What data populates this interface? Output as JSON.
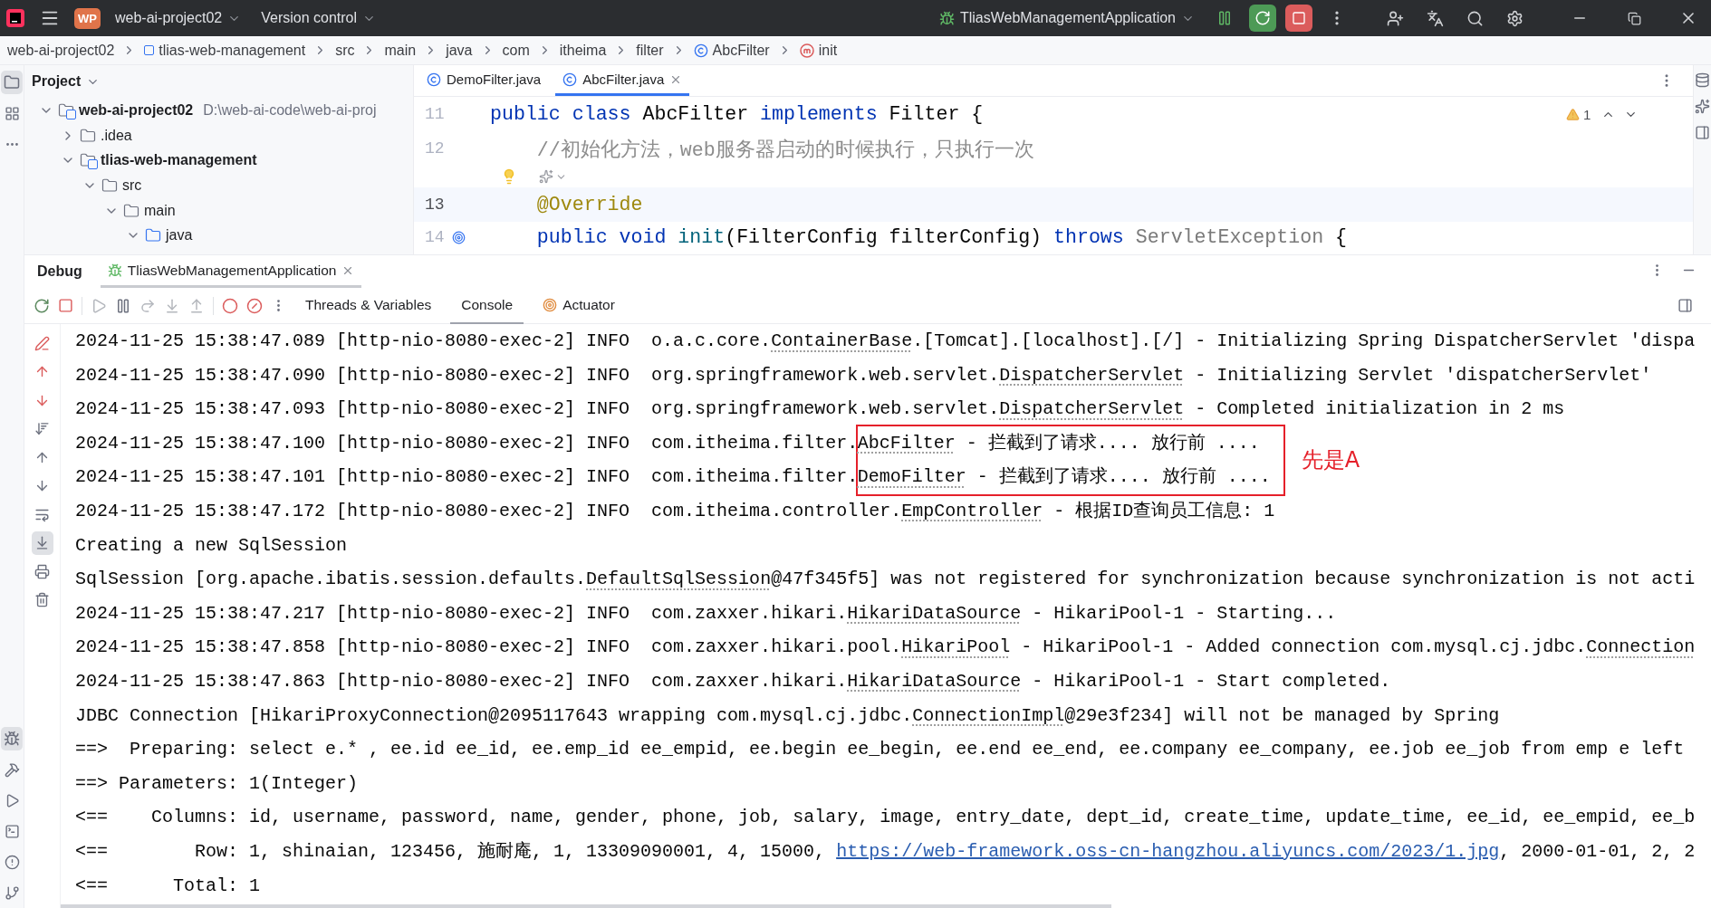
{
  "title_bar": {
    "project_badge": "WP",
    "project": "web-ai-project02",
    "vcs": "Version control",
    "run_config": "TliasWebManagementApplication"
  },
  "breadcrumbs": [
    {
      "label": "web-ai-project02",
      "kind": "plain"
    },
    {
      "label": "tlias-web-management",
      "kind": "module"
    },
    {
      "label": "src",
      "kind": "plain"
    },
    {
      "label": "main",
      "kind": "plain"
    },
    {
      "label": "java",
      "kind": "plain"
    },
    {
      "label": "com",
      "kind": "plain"
    },
    {
      "label": "itheima",
      "kind": "plain"
    },
    {
      "label": "filter",
      "kind": "plain"
    },
    {
      "label": "AbcFilter",
      "kind": "class"
    },
    {
      "label": "init",
      "kind": "method"
    }
  ],
  "project_panel": {
    "title": "Project",
    "tree": [
      {
        "label": "web-ai-project02",
        "path": "D:\\web-ai-code\\web-ai-proj",
        "kind": "module",
        "expanded": true,
        "children": [
          {
            "label": ".idea",
            "kind": "folder",
            "expanded": false
          },
          {
            "label": "tlias-web-management",
            "kind": "module",
            "expanded": true,
            "children": [
              {
                "label": "src",
                "kind": "folder",
                "expanded": true,
                "children": [
                  {
                    "label": "main",
                    "kind": "folder",
                    "expanded": true,
                    "children": [
                      {
                        "label": "java",
                        "kind": "source",
                        "expanded": true
                      }
                    ]
                  }
                ]
              }
            ]
          }
        ]
      }
    ]
  },
  "editor": {
    "tabs": [
      {
        "label": "DemoFilter.java",
        "selected": false
      },
      {
        "label": "AbcFilter.java",
        "selected": true
      }
    ],
    "warnings": "1",
    "lines": [
      {
        "kind": "code",
        "number": "11",
        "current": false,
        "overridden": false,
        "segments": [
          {
            "t": "public class ",
            "kind": "kw"
          },
          {
            "t": "AbcFilter ",
            "kind": "plain"
          },
          {
            "t": "implements ",
            "kind": "kw"
          },
          {
            "t": "Filter {",
            "kind": "plain"
          }
        ]
      },
      {
        "kind": "code",
        "number": "12",
        "current": false,
        "overridden": false,
        "segments": [
          {
            "t": "    //初始化方法，web服务器启动的时候执行，只执行一次",
            "kind": "comment"
          }
        ]
      },
      {
        "kind": "hint"
      },
      {
        "kind": "code",
        "number": "13",
        "current": true,
        "overridden": false,
        "segments": [
          {
            "t": "    @Override",
            "kind": "annotation"
          }
        ]
      },
      {
        "kind": "code",
        "number": "14",
        "current": false,
        "overridden": true,
        "segments": [
          {
            "t": "    public void ",
            "kind": "kw"
          },
          {
            "t": "init",
            "kind": "method"
          },
          {
            "t": "(FilterConfig filterConfig) ",
            "kind": "plain"
          },
          {
            "t": "throws ",
            "kind": "kw"
          },
          {
            "t": "ServletException",
            "kind": "muted"
          },
          {
            "t": " {",
            "kind": "plain"
          }
        ]
      }
    ]
  },
  "debug": {
    "title": "Debug",
    "session": "TliasWebManagementApplication",
    "tabs": [
      {
        "label": "Threads & Variables",
        "kind": "plain",
        "selected": false
      },
      {
        "label": "Console",
        "kind": "plain",
        "selected": true
      },
      {
        "label": "Actuator",
        "kind": "actuator",
        "selected": false
      }
    ],
    "annotation": "先是A",
    "console": [
      {
        "boxed": false,
        "segments": [
          {
            "t": "2024-11-25 15:38:47.089 [http-nio-8080-exec-2] INFO  o.a.c.core.",
            "kind": "plain"
          },
          {
            "t": "ContainerBase",
            "kind": "ref"
          },
          {
            "t": ".[Tomcat].[localhost].[/] - Initializing Spring DispatcherServlet 'dispa",
            "kind": "plain"
          }
        ]
      },
      {
        "boxed": false,
        "segments": [
          {
            "t": "2024-11-25 15:38:47.090 [http-nio-8080-exec-2] INFO  org.springframework.web.servlet.",
            "kind": "plain"
          },
          {
            "t": "DispatcherServlet",
            "kind": "ref"
          },
          {
            "t": " - Initializing Servlet 'dispatcherServlet'",
            "kind": "plain"
          }
        ]
      },
      {
        "boxed": false,
        "segments": [
          {
            "t": "2024-11-25 15:38:47.093 [http-nio-8080-exec-2] INFO  org.springframework.web.servlet.",
            "kind": "plain"
          },
          {
            "t": "DispatcherServlet",
            "kind": "ref"
          },
          {
            "t": " - Completed initialization in 2 ms",
            "kind": "plain"
          }
        ]
      },
      {
        "boxed": true,
        "segments": [
          {
            "t": "2024-11-25 15:38:47.100 [http-nio-8080-exec-2] INFO  com.itheima.filter.",
            "kind": "plain"
          },
          {
            "t": "AbcFilter",
            "kind": "ref"
          },
          {
            "t": " - 拦截到了请求.... 放行前 ....",
            "kind": "plain"
          }
        ]
      },
      {
        "boxed": true,
        "segments": [
          {
            "t": "2024-11-25 15:38:47.101 [http-nio-8080-exec-2] INFO  com.itheima.filter.",
            "kind": "plain"
          },
          {
            "t": "DemoFilter",
            "kind": "ref"
          },
          {
            "t": " - 拦截到了请求.... 放行前 ....",
            "kind": "plain"
          }
        ]
      },
      {
        "boxed": false,
        "segments": [
          {
            "t": "2024-11-25 15:38:47.172 [http-nio-8080-exec-2] INFO  com.itheima.controller.",
            "kind": "plain"
          },
          {
            "t": "EmpController",
            "kind": "ref"
          },
          {
            "t": " - 根据ID查询员工信息: 1",
            "kind": "plain"
          }
        ]
      },
      {
        "boxed": false,
        "segments": [
          {
            "t": "Creating a new SqlSession",
            "kind": "plain"
          }
        ]
      },
      {
        "boxed": false,
        "segments": [
          {
            "t": "SqlSession [org.apache.ibatis.session.defaults.",
            "kind": "plain"
          },
          {
            "t": "DefaultSqlSession",
            "kind": "ref"
          },
          {
            "t": "@47f345f5] was not registered for synchronization because synchronization is not acti",
            "kind": "plain"
          }
        ]
      },
      {
        "boxed": false,
        "segments": [
          {
            "t": "2024-11-25 15:38:47.217 [http-nio-8080-exec-2] INFO  com.zaxxer.hikari.",
            "kind": "plain"
          },
          {
            "t": "HikariDataSource",
            "kind": "ref"
          },
          {
            "t": " - HikariPool-1 - Starting...",
            "kind": "plain"
          }
        ]
      },
      {
        "boxed": false,
        "segments": [
          {
            "t": "2024-11-25 15:38:47.858 [http-nio-8080-exec-2] INFO  com.zaxxer.hikari.pool.",
            "kind": "plain"
          },
          {
            "t": "HikariPool",
            "kind": "ref"
          },
          {
            "t": " - HikariPool-1 - Added connection com.mysql.cj.jdbc.",
            "kind": "plain"
          },
          {
            "t": "Connection",
            "kind": "ref"
          }
        ]
      },
      {
        "boxed": false,
        "segments": [
          {
            "t": "2024-11-25 15:38:47.863 [http-nio-8080-exec-2] INFO  com.zaxxer.hikari.",
            "kind": "plain"
          },
          {
            "t": "HikariDataSource",
            "kind": "ref"
          },
          {
            "t": " - HikariPool-1 - Start completed.",
            "kind": "plain"
          }
        ]
      },
      {
        "boxed": false,
        "segments": [
          {
            "t": "JDBC Connection [HikariProxyConnection@2095117643 wrapping com.mysql.cj.jdbc.",
            "kind": "plain"
          },
          {
            "t": "ConnectionImpl",
            "kind": "ref"
          },
          {
            "t": "@29e3f234] will not be managed by Spring",
            "kind": "plain"
          }
        ]
      },
      {
        "boxed": false,
        "segments": [
          {
            "t": "==>  Preparing: select e.* , ee.id ee_id, ee.emp_id ee_empid, ee.begin ee_begin, ee.end ee_end, ee.company ee_company, ee.job ee_job from emp e left",
            "kind": "plain"
          }
        ]
      },
      {
        "boxed": false,
        "segments": [
          {
            "t": "==> Parameters: 1(Integer)",
            "kind": "plain"
          }
        ]
      },
      {
        "boxed": false,
        "segments": [
          {
            "t": "<==    Columns: id, username, password, name, gender, phone, job, salary, image, entry_date, dept_id, create_time, update_time, ee_id, ee_empid, ee_b",
            "kind": "plain"
          }
        ]
      },
      {
        "boxed": false,
        "segments": [
          {
            "t": "<==        Row: 1, shinaian, 123456, 施耐庵, 1, 13309090001, 4, 15000, ",
            "kind": "plain"
          },
          {
            "t": "https://web-framework.oss-cn-hangzhou.aliyuncs.com/2023/1.jpg",
            "kind": "link"
          },
          {
            "t": ", 2000-01-01, 2, 2",
            "kind": "plain"
          }
        ]
      },
      {
        "boxed": false,
        "segments": [
          {
            "t": "<==      Total: 1",
            "kind": "plain"
          }
        ]
      }
    ]
  }
}
